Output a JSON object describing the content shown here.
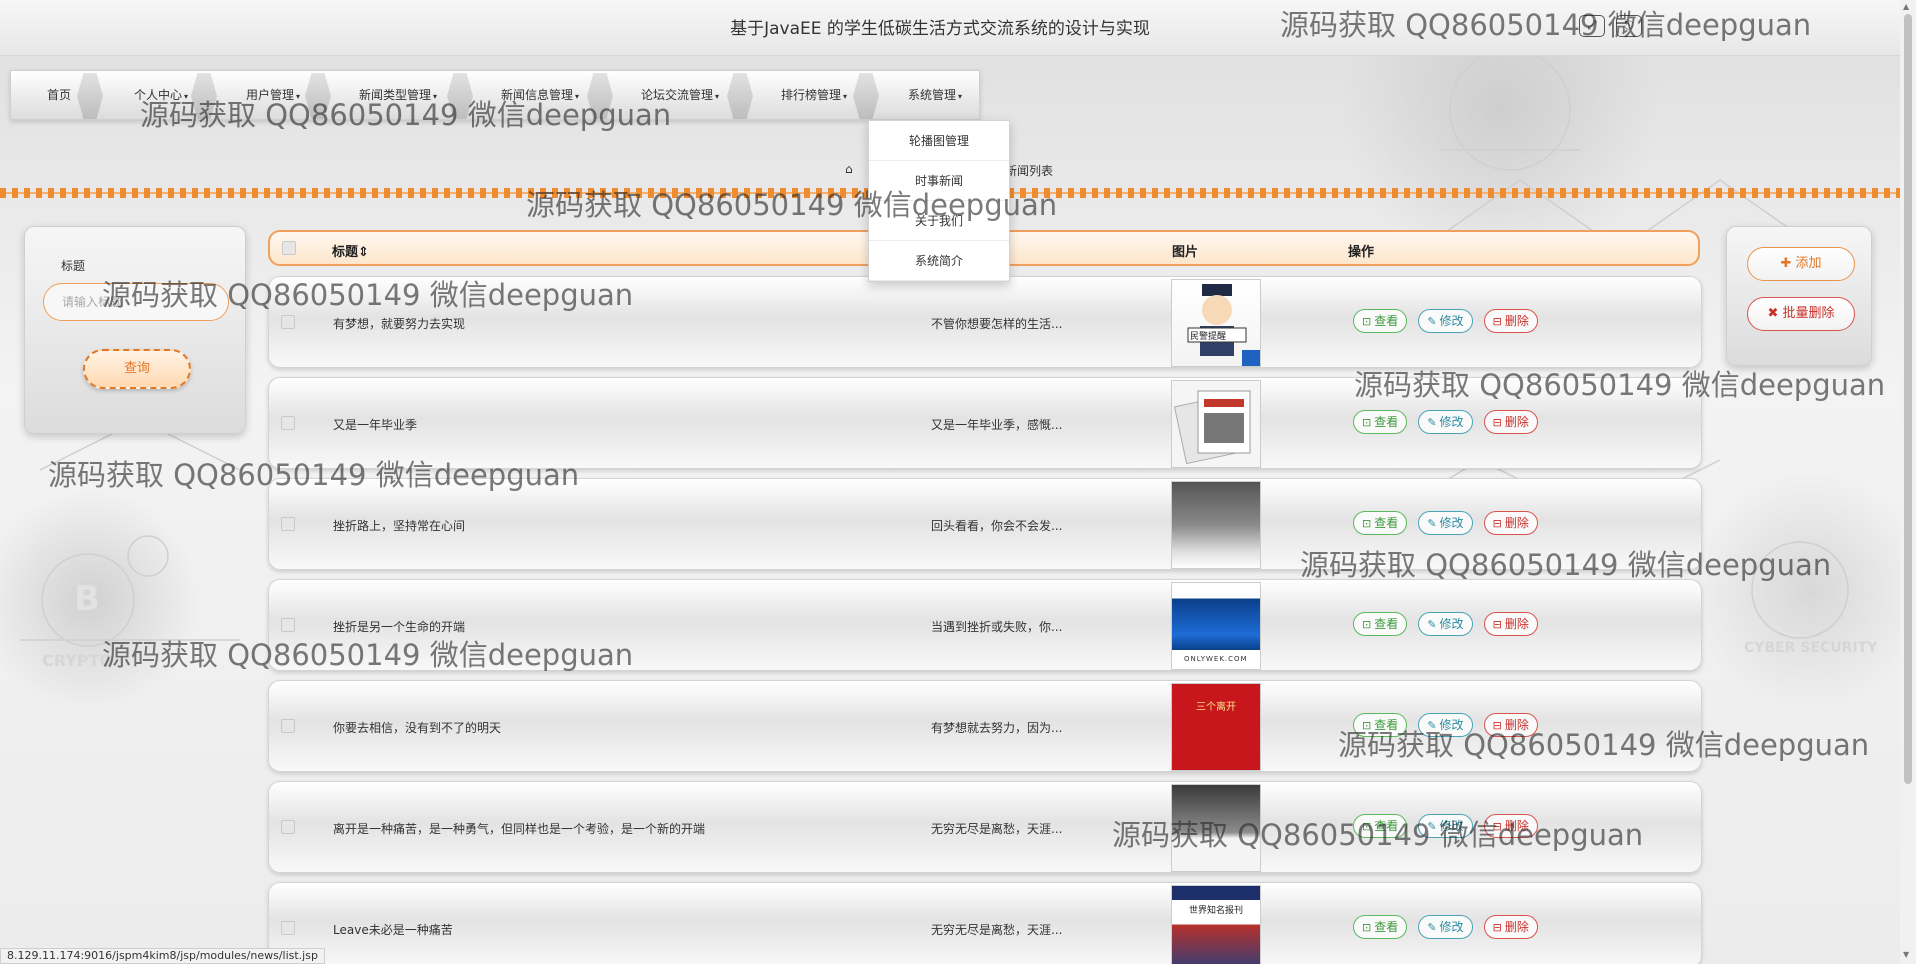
{
  "site_title": "基于JavaEE 的学生低碳生活方式交流系统的设计与实现",
  "nav": {
    "items": [
      {
        "label": "首页",
        "caret": ""
      },
      {
        "label": "个人中心",
        "caret": "▾"
      },
      {
        "label": "用户管理",
        "caret": "▾"
      },
      {
        "label": "新闻类型管理",
        "caret": "▾"
      },
      {
        "label": "新闻信息管理",
        "caret": "▾"
      },
      {
        "label": "论坛交流管理",
        "caret": "▾"
      },
      {
        "label": "排行榜管理",
        "caret": "▾"
      },
      {
        "label": "系统管理",
        "caret": "▾"
      }
    ]
  },
  "dropdown": {
    "items": [
      "轮播图管理",
      "时事新闻",
      "关于我们",
      "系统简介"
    ]
  },
  "breadcrumb": {
    "home_icon": "⌂",
    "text": "新闻列表"
  },
  "search": {
    "label": "标题",
    "placeholder": "请输入标题",
    "button": "查询"
  },
  "actions": {
    "add": "添加",
    "batch_delete": "批量删除"
  },
  "table": {
    "headers": {
      "title": "标题",
      "sort": "⇕",
      "image": "图片",
      "ops": "操作"
    },
    "op_labels": {
      "view": "查看",
      "edit": "修改",
      "delete": "删除"
    },
    "rows": [
      {
        "title": "有梦想，就要努力去实现",
        "content": "不管你想要怎样的生活...",
        "thumb_text": "民警提醒"
      },
      {
        "title": "又是一年毕业季",
        "content": "又是一年毕业季，感慨...",
        "thumb_text": ""
      },
      {
        "title": "挫折路上，坚持常在心间",
        "content": "回头看看，你会不会发...",
        "thumb_text": ""
      },
      {
        "title": "挫折是另一个生命的开端",
        "content": "当遇到挫折或失败，你...",
        "thumb_text": "ONLYWEK.COM"
      },
      {
        "title": "你要去相信，没有到不了的明天",
        "content": "有梦想就去努力，因为...",
        "thumb_text": "三个离开"
      },
      {
        "title": "离开是一种痛苦，是一种勇气，但同样也是一个考验，是一个新的开端",
        "content": "无穷无尽是离愁，天涯...",
        "thumb_text": ""
      },
      {
        "title": "Leave未必是一种痛苦",
        "content": "无穷无尽是离愁，天涯...",
        "thumb_text": "世界知名报刊"
      }
    ]
  },
  "status_url": "8.129.11.174:9016/jspm4kim8/jsp/modules/news/list.jsp",
  "watermark": "源码获取 QQ86050149 微信deepguan",
  "colors": {
    "accent_orange": "#f08c2e",
    "view_green": "#5cb85c",
    "edit_teal": "#4aa3b5",
    "delete_red": "#d9534f"
  }
}
